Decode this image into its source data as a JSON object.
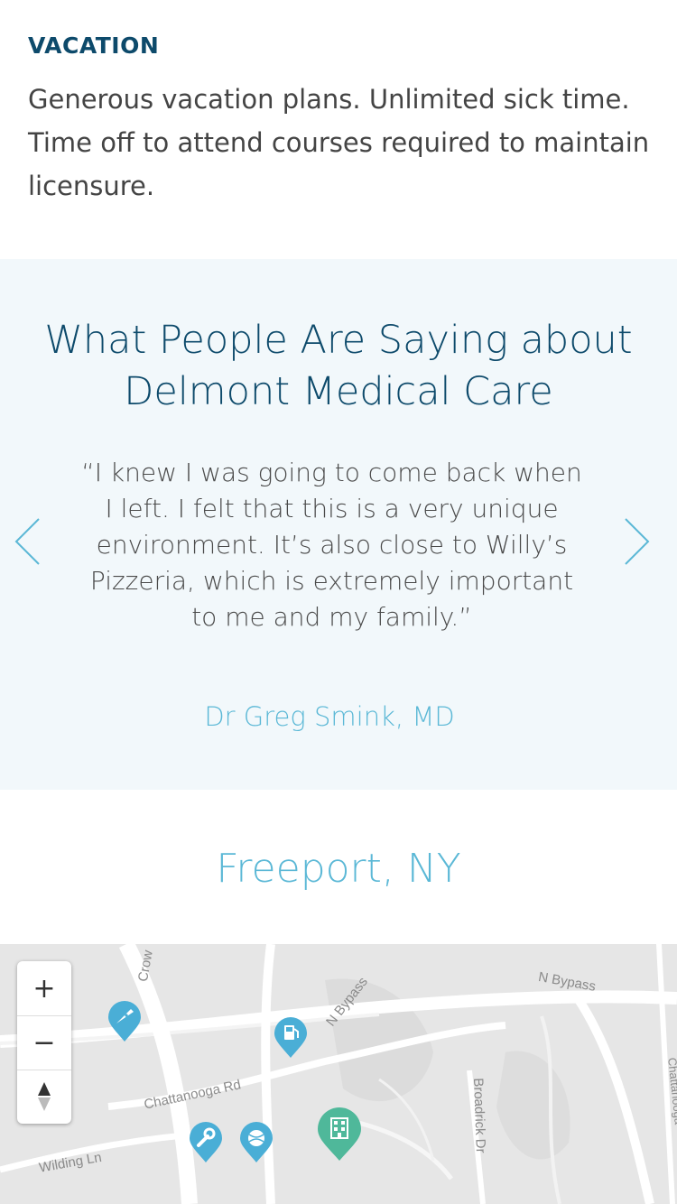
{
  "benefit": {
    "title": "VACATION",
    "text": "Generous vacation plans. Unlimited sick time. Time off to attend courses required to maintain licensure."
  },
  "testimonials": {
    "title": "What People Are Saying about Delmont Medical Care",
    "quote": "“I knew I was going to come back when I left. I felt that this is a very unique environment. It’s also close to Willy’s Pizzeria, which is extremely important to me and my family.”",
    "author": "Dr Greg Smink, MD",
    "prev_icon": "chevron-left-icon",
    "next_icon": "chevron-right-icon"
  },
  "location": {
    "title": "Freeport, NY"
  },
  "map": {
    "roads": {
      "n_bypass_1": "N Bypass",
      "n_bypass_2": "N Bypass",
      "chattanooga": "Chattanooga Rd",
      "wilding": "Wilding Ln",
      "broadrick": "Broadrick Dr",
      "crow": "Crow",
      "chattanooga_right": "Chattanooga"
    },
    "controls": {
      "zoom_in": "+",
      "zoom_out": "−"
    },
    "pins": [
      {
        "name": "pizza-pin",
        "icon": "pizza-icon"
      },
      {
        "name": "gas-station-pin",
        "icon": "gas-pump-icon"
      },
      {
        "name": "repair-pin",
        "icon": "wrench-icon"
      },
      {
        "name": "sports-pin",
        "icon": "ball-icon"
      },
      {
        "name": "hospital-pin",
        "icon": "building-icon"
      }
    ],
    "colors": {
      "pin_blue": "#4aaed6",
      "pin_green": "#4fb89a"
    }
  },
  "colors": {
    "primary": "#0d4a6b",
    "accent": "#5bb8d6",
    "testimonial_bg": "#f2f8fb"
  }
}
